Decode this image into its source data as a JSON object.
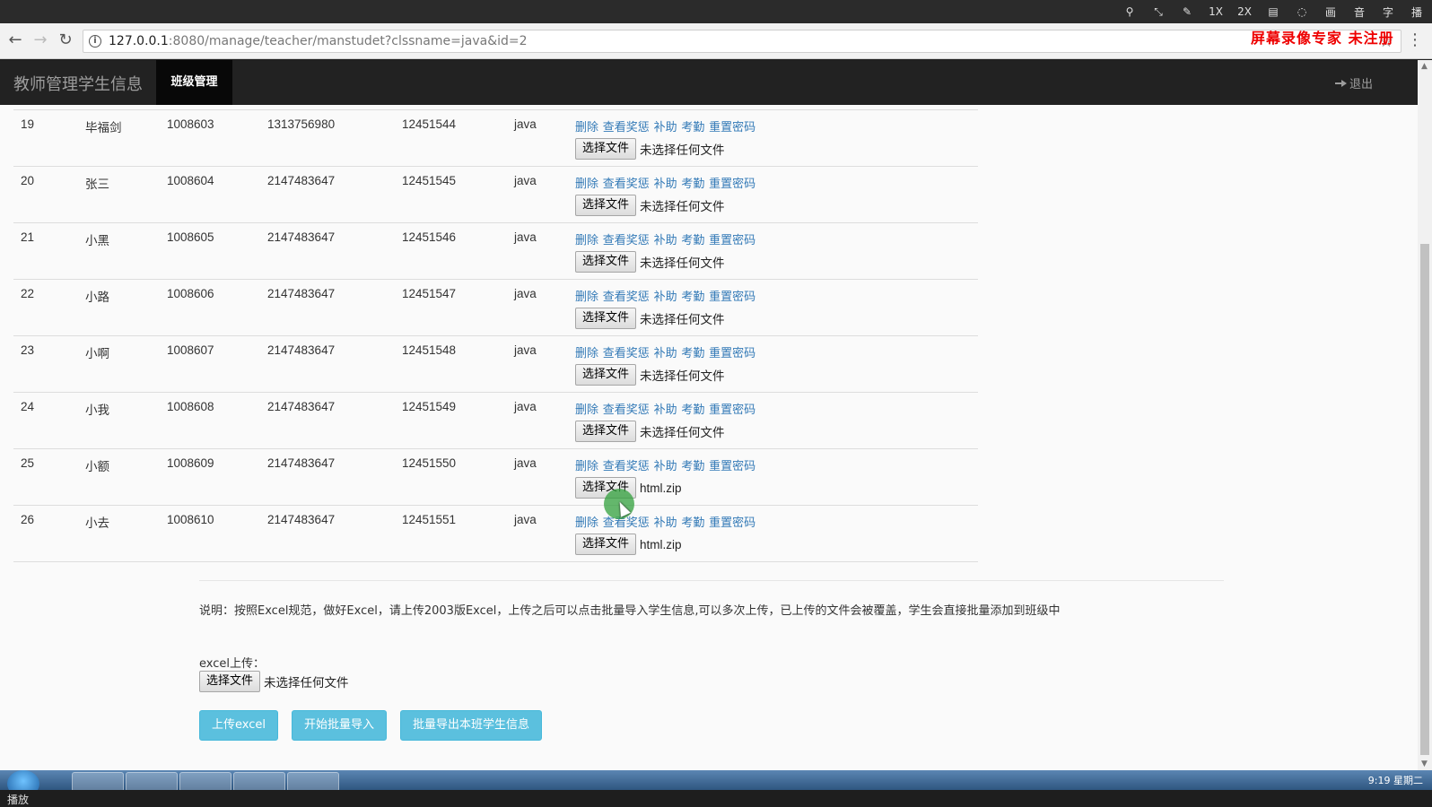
{
  "recorder": {
    "items": [
      "1X",
      "2X",
      "画",
      "音",
      "字",
      "播"
    ],
    "watermark": "屏幕录像专家 未注册",
    "status": "播放"
  },
  "browser": {
    "url_host": "127.0.0.1",
    "url_path": ":8080/manage/teacher/manstudet?clssname=java&id=2"
  },
  "navbar": {
    "brand": "教师管理学生信息",
    "active_item": "班级管理",
    "logout": "退出"
  },
  "operations": [
    "删除",
    "查看奖惩",
    "补助",
    "考勤",
    "重置密码"
  ],
  "file_button": "选择文件",
  "students": [
    {
      "id": "19",
      "name": "毕福剑",
      "sno": "1008603",
      "phone": "1313756980",
      "num": "12451544",
      "class": "java",
      "file": "未选择任何文件"
    },
    {
      "id": "20",
      "name": "张三",
      "sno": "1008604",
      "phone": "2147483647",
      "num": "12451545",
      "class": "java",
      "file": "未选择任何文件"
    },
    {
      "id": "21",
      "name": "小黑",
      "sno": "1008605",
      "phone": "2147483647",
      "num": "12451546",
      "class": "java",
      "file": "未选择任何文件"
    },
    {
      "id": "22",
      "name": "小路",
      "sno": "1008606",
      "phone": "2147483647",
      "num": "12451547",
      "class": "java",
      "file": "未选择任何文件"
    },
    {
      "id": "23",
      "name": "小啊",
      "sno": "1008607",
      "phone": "2147483647",
      "num": "12451548",
      "class": "java",
      "file": "未选择任何文件"
    },
    {
      "id": "24",
      "name": "小我",
      "sno": "1008608",
      "phone": "2147483647",
      "num": "12451549",
      "class": "java",
      "file": "未选择任何文件"
    },
    {
      "id": "25",
      "name": "小额",
      "sno": "1008609",
      "phone": "2147483647",
      "num": "12451550",
      "class": "java",
      "file": "html.zip"
    },
    {
      "id": "26",
      "name": "小去",
      "sno": "1008610",
      "phone": "2147483647",
      "num": "12451551",
      "class": "java",
      "file": "html.zip"
    }
  ],
  "note": "说明：按照Excel规范，做好Excel，请上传2003版Excel，上传之后可以点击批量导入学生信息,可以多次上传，已上传的文件会被覆盖，学生会直接批量添加到班级中",
  "upload": {
    "label": "excel上传：",
    "file_status": "未选择任何文件"
  },
  "actions": {
    "upload": "上传excel",
    "import": "开始批量导入",
    "export": "批量导出本班学生信息"
  },
  "taskbar": {
    "clock": "9:19 星期二"
  }
}
